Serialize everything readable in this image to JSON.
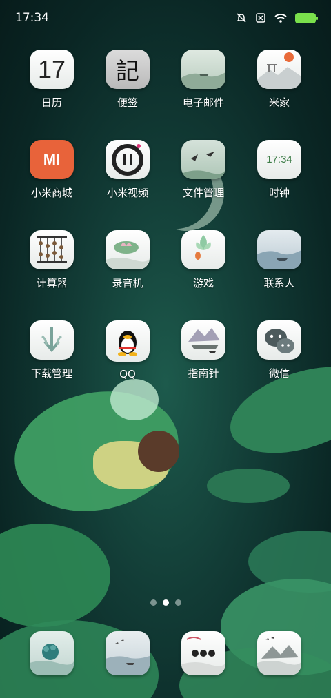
{
  "status_bar": {
    "time": "17:34",
    "mute_icon": "bell-off-icon",
    "nosim_icon": "no-sim-icon",
    "wifi_icon": "wifi-icon",
    "battery_icon": "battery-charging-icon"
  },
  "apps": [
    {
      "label": "日历",
      "icon": "calendar-icon",
      "glyph": "17"
    },
    {
      "label": "便签",
      "icon": "notes-icon",
      "glyph": "記"
    },
    {
      "label": "电子邮件",
      "icon": "email-icon",
      "glyph": ""
    },
    {
      "label": "米家",
      "icon": "mijia-icon",
      "glyph": ""
    },
    {
      "label": "小米商城",
      "icon": "mi-store-icon",
      "glyph": "MI"
    },
    {
      "label": "小米视频",
      "icon": "mi-video-icon",
      "glyph": ""
    },
    {
      "label": "文件管理",
      "icon": "file-manager-icon",
      "glyph": ""
    },
    {
      "label": "时钟",
      "icon": "clock-icon",
      "glyph": "17:34"
    },
    {
      "label": "计算器",
      "icon": "calculator-icon",
      "glyph": ""
    },
    {
      "label": "录音机",
      "icon": "recorder-icon",
      "glyph": ""
    },
    {
      "label": "游戏",
      "icon": "games-icon",
      "glyph": ""
    },
    {
      "label": "联系人",
      "icon": "contacts-icon",
      "glyph": ""
    },
    {
      "label": "下载管理",
      "icon": "downloads-icon",
      "glyph": ""
    },
    {
      "label": "QQ",
      "icon": "qq-icon",
      "glyph": ""
    },
    {
      "label": "指南针",
      "icon": "compass-icon",
      "glyph": ""
    },
    {
      "label": "微信",
      "icon": "wechat-icon",
      "glyph": ""
    }
  ],
  "page_indicator": {
    "count": 3,
    "active": 2
  },
  "dock": [
    {
      "icon": "phone-icon"
    },
    {
      "icon": "messages-icon"
    },
    {
      "icon": "browser-icon"
    },
    {
      "icon": "camera-icon"
    }
  ]
}
